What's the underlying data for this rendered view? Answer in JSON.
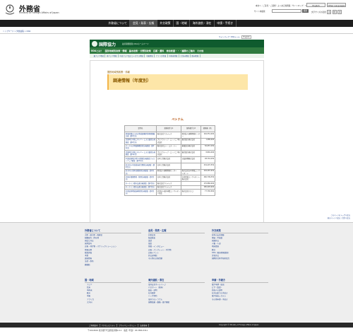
{
  "header": {
    "site_title": "外務省",
    "site_subtitle": "Ministry of Foreign Affairs of Japan",
    "util_links": "本文へ｜ご意見・ご感想｜よくある質問集｜サイトマップ｜リンク集",
    "lang_english": "English",
    "lang_others": "Other Languages",
    "search_label": "サイト内検索",
    "search_placeholder": "",
    "search_button": "検索",
    "fontsize_label": "文字サイズの変更",
    "fontsize_options": [
      "小",
      "中",
      "大"
    ]
  },
  "gnav": [
    "外務省について",
    "会見・発表・広報",
    "外交政策",
    "国・地域",
    "海外渡航・滞在",
    "申請・手続き"
  ],
  "breadcrumb": "トップページ > 外交政策 > ODA",
  "oda": {
    "tools": [
      "サイトマップ",
      "ODAメール",
      "English"
    ],
    "banner_title": "国際協力",
    "banner_sub": "政府開発援助 ODAホームページ",
    "menu": [
      "ODAとは？",
      "国別地域別政策・情報",
      "基本政策・分野別政策",
      "広報・資料",
      "参加希望・・・連携のご案内",
      "その他"
    ],
    "submenu": [
      "東アジア地域",
      "南アジア地域",
      "中央アジア及びコーカサス地域",
      "中東地域",
      "アフリカ地域",
      "中南米地域",
      "大洋州地域",
      "欧州地域"
    ],
    "section_label": "国別地域別政策・情報",
    "heading": "調達情報（年度別）",
    "country": "ベトナム"
  },
  "table": {
    "headers": [
      "案件名",
      "契約相手方1",
      "契約相手方2",
      "契約額（円）"
    ],
    "rows": [
      [
        "地域保健のための地域医療提供体制整備計画（第2次分）",
        "株式会社アスメック",
        "財団法人国際開発センター",
        "164,551,000"
      ],
      [
        "北部再生可能エネルギー による電化計画調査（第2次分）",
        "プロアクティブ・エンジニア株式会社",
        "東北電力株式会社",
        "1,080,000"
      ],
      [
        "ビーチの立地電源構造化計画調査（第2年次）",
        "株式会社エー・エス・ティ",
        "東電設計株式会社",
        "56,957,250"
      ],
      [
        "北部再生可能エネルギー による電化計画調査（第3年次）",
        "プロアクティブ・エンジニア株式会社",
        "東北電力株式会社",
        "8,891,400"
      ],
      [
        "中部高原地方地下水開発計画調査フォローアップ調査（第2年次）",
        "日本工営株式会社",
        "日鉱探開株式会社",
        "28,716,250"
      ],
      [
        "紅河河川中流域を総合開発計画調査（第2次分）",
        "日本工営株式会社",
        "",
        "234,407,550"
      ],
      [
        "紅河河川全体流域管理計画調査（第2次分）",
        "財団法人国際開発センター",
        "株式会社日本地域コンサルタント",
        "204,487,950"
      ],
      [
        "全国水資源開発・管理計画調査（第2次分）",
        "日本工営株式会社",
        "日本環境コンサルタント株式会社",
        "260,799,350"
      ],
      [
        "ホーチミン都市交通計画調査（第2次分）",
        "株式会社アルメック",
        "",
        "176,860,000"
      ],
      [
        "ホーチミン都市交通計画調査（第3次分）",
        "株式会社アルメック",
        "",
        "180,905,900"
      ],
      [
        "中部高原地域森林管理計画調査（第2次分）",
        "社団法人海外林業コンサルタンツ協会",
        "株式会社パスコ",
        "77,765,650"
      ]
    ]
  },
  "pagetop": [
    "このページのトップへ戻る",
    "前のページへ戻る｜目次へ戻る"
  ],
  "sitemap": [
    {
      "title": "外務省について",
      "items": [
        "大臣・副大臣・政務官",
        "組織案内・所在地",
        "国会と外交",
        "採用案内",
        "広報・刊行物・パブリックリレーション",
        "情報公開",
        "政策評価",
        "予算",
        "調達情報",
        "法律・条約",
        "図書館"
      ]
    },
    {
      "title": "会見・発表・広報",
      "items": [
        "記者会見",
        "報道発表",
        "談話",
        "演説",
        "寄稿・インタビュー",
        "広報・パンフレット・刊行物",
        "広報イベント",
        "外交史料館",
        "その他の広報活動"
      ]
    },
    {
      "title": "外交政策",
      "items": [
        "日本の安全保障",
        "軍縮・不拡散",
        "国連外交",
        "人権・人道",
        "地球環境",
        "経済",
        "ODA（政府開発援助）",
        "文化外交",
        "国際的な科学技術協力"
      ]
    },
    {
      "title": "国・地域",
      "items": [
        "アジア",
        "北米",
        "中南米",
        "欧州",
        "中東",
        "アフリカ",
        "大洋州"
      ]
    },
    {
      "title": "海外渡航・滞在",
      "items": [
        "海外安全ホームページ",
        "パスポート（旅券）",
        "届出・証明",
        "在外選挙",
        "ハーグ条約",
        "海外でのトラブル",
        "国際結婚・離婚・養子縁組"
      ]
    },
    {
      "title": "申請・手続き",
      "items": [
        "電子申請・届出",
        "ビザ（査証）",
        "外国人の証明",
        "在外公館での手続き",
        "電子届出システム",
        "その他申請・手続き"
      ]
    }
  ],
  "bottom_links": [
    "ご利用案内",
    "アクセシビリティ",
    "プライバシーポリシー",
    "法的事項"
  ],
  "copyright": "Copyright © Ministry of Foreign Affairs of Japan",
  "address": "〒100-8919 東京都千代田区霞が関2-2-1　電話（代表）03-3580-3311"
}
